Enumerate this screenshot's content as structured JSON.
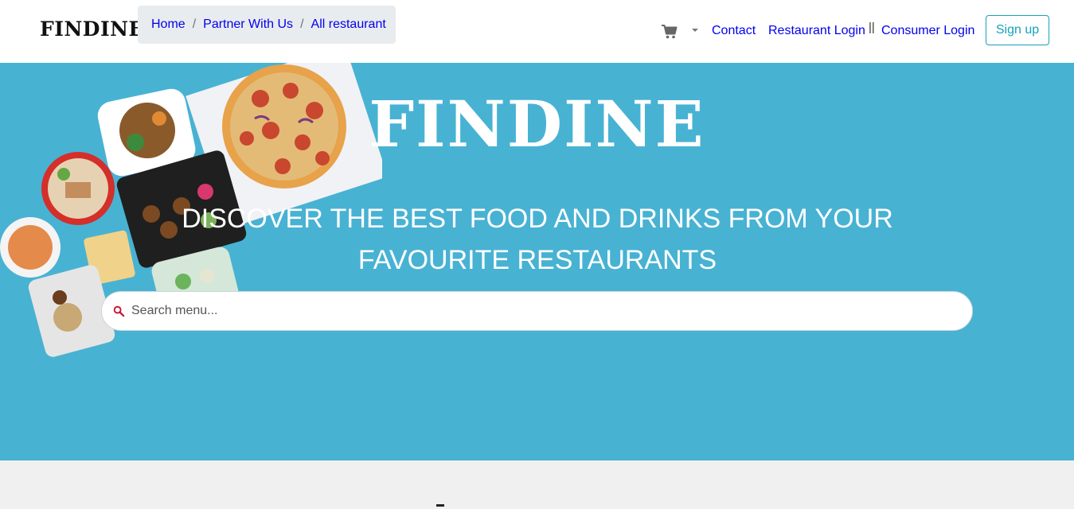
{
  "nav": {
    "brand": "FINDINE",
    "breadcrumb": [
      "Home",
      "Partner With Us",
      "All restaurant"
    ],
    "breadcrumb_separator": "/",
    "cart_icon": "cart-icon",
    "contact": "Contact",
    "restaurant_login": "Restaurant Login",
    "divider": "||",
    "consumer_login": "Consumer Login",
    "signup": "Sign up"
  },
  "hero": {
    "title": "FINDINE",
    "subtitle_line1": "DISCOVER THE BEST FOOD AND DRINKS FROM YOUR",
    "subtitle_line2": "FAVOURITE RESTAURANTS",
    "search_placeholder": "Search menu...",
    "search_icon": "search-icon",
    "background_color": "#48b2d3"
  },
  "colors": {
    "link": "#0000ee",
    "accent": "#17a2b8",
    "search_icon": "#c8102e"
  }
}
